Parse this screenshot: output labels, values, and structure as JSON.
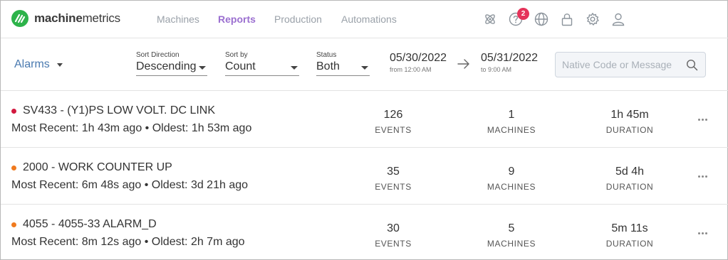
{
  "brand": {
    "name_bold": "machine",
    "name_rest": "metrics",
    "accent": "#2db34a"
  },
  "nav": {
    "items": [
      {
        "label": "Machines",
        "active": false
      },
      {
        "label": "Reports",
        "active": true
      },
      {
        "label": "Production",
        "active": false
      },
      {
        "label": "Automations",
        "active": false
      }
    ],
    "icons": [
      "atom-icon",
      "help-icon",
      "globe-icon",
      "lock-icon",
      "gear-icon",
      "user-icon"
    ],
    "help_badge": "2",
    "active_color": "#9b6fd0"
  },
  "filters": {
    "report_type": "Alarms",
    "sort_direction": {
      "label": "Sort Direction",
      "value": "Descending"
    },
    "sort_by": {
      "label": "Sort by",
      "value": "Count"
    },
    "status": {
      "label": "Status",
      "value": "Both"
    },
    "date_from": {
      "date": "05/30/2022",
      "sub": "from 12:00 AM"
    },
    "date_to": {
      "date": "05/31/2022",
      "sub": "to 9:00 AM"
    },
    "search_placeholder": "Native Code or Message"
  },
  "alarms": [
    {
      "title": "SV433 - (Y1)PS LOW VOLT. DC LINK",
      "recent": "Most Recent: 1h 43m ago • Oldest: 1h 53m ago",
      "status_color": "#d2193f",
      "events": "126",
      "machines": "1",
      "duration": "1h 45m"
    },
    {
      "title": "2000 - WORK COUNTER UP",
      "recent": "Most Recent: 6m 48s ago • Oldest: 3d 21h ago",
      "status_color": "#f07a1e",
      "events": "35",
      "machines": "9",
      "duration": "5d 4h"
    },
    {
      "title": "4055 - 4055-33 ALARM_D",
      "recent": "Most Recent: 8m 12s ago • Oldest: 2h 7m ago",
      "status_color": "#f07a1e",
      "events": "30",
      "machines": "5",
      "duration": "5m 11s"
    }
  ],
  "captions": {
    "events": "EVENTS",
    "machines": "MACHINES",
    "duration": "DURATION"
  }
}
